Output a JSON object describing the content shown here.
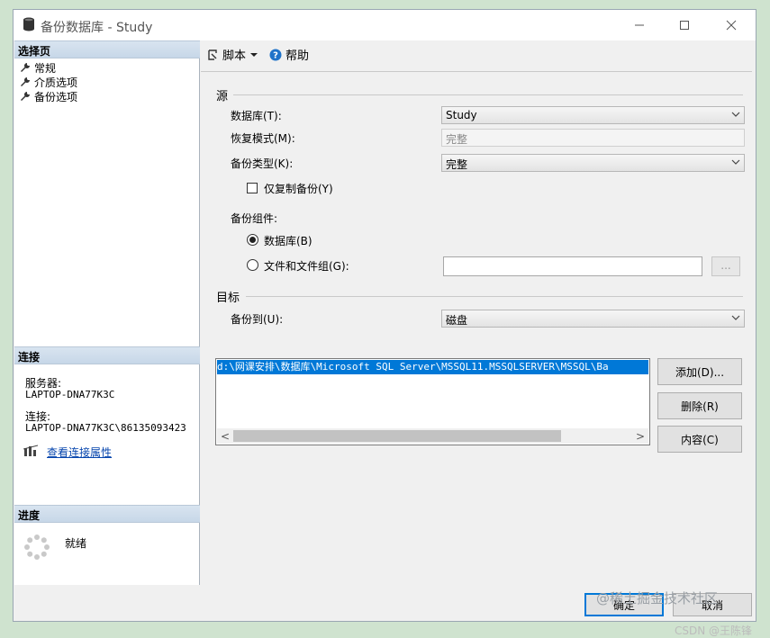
{
  "window": {
    "title": "备份数据库 - Study"
  },
  "left_panel": {
    "pages_header": "选择页",
    "pages": [
      {
        "label": "常规"
      },
      {
        "label": "介质选项"
      },
      {
        "label": "备份选项"
      }
    ],
    "connection_header": "连接",
    "server_label": "服务器:",
    "server_value": "LAPTOP-DNA77K3C",
    "connection_label": "连接:",
    "connection_value": "LAPTOP-DNA77K3C\\86135093423",
    "view_properties_link": "查看连接属性",
    "progress_header": "进度",
    "progress_status": "就绪"
  },
  "toolbar": {
    "script_label": "脚本",
    "help_label": "帮助"
  },
  "source": {
    "group_title": "源",
    "database_label": "数据库(T):",
    "database_value": "Study",
    "recovery_label": "恢复模式(M):",
    "recovery_value": "完整",
    "backup_type_label": "备份类型(K):",
    "backup_type_value": "完整",
    "copy_only_label": "仅复制备份(Y)",
    "copy_only_checked": false,
    "component_label": "备份组件:",
    "component_database_label": "数据库(B)",
    "component_files_label": "文件和文件组(G):",
    "selected_component": "database",
    "browse_label": "..."
  },
  "destination": {
    "group_title": "目标",
    "backup_to_label": "备份到(U):",
    "backup_to_value": "磁盘",
    "paths": [
      "d:\\网课安排\\数据库\\Microsoft SQL Server\\MSSQL11.MSSQLSERVER\\MSSQL\\Ba"
    ],
    "add_button": "添加(D)...",
    "remove_button": "删除(R)",
    "contents_button": "内容(C)"
  },
  "footer": {
    "ok_button": "确定",
    "cancel_button": "取消"
  },
  "watermark": {
    "line1": "@稀土掘金技术社区",
    "line2": "CSDN @王陈锋"
  },
  "colors": {
    "selection": "#0078d7",
    "header_gradient": "#c7d7e8",
    "link": "#0645ad"
  }
}
